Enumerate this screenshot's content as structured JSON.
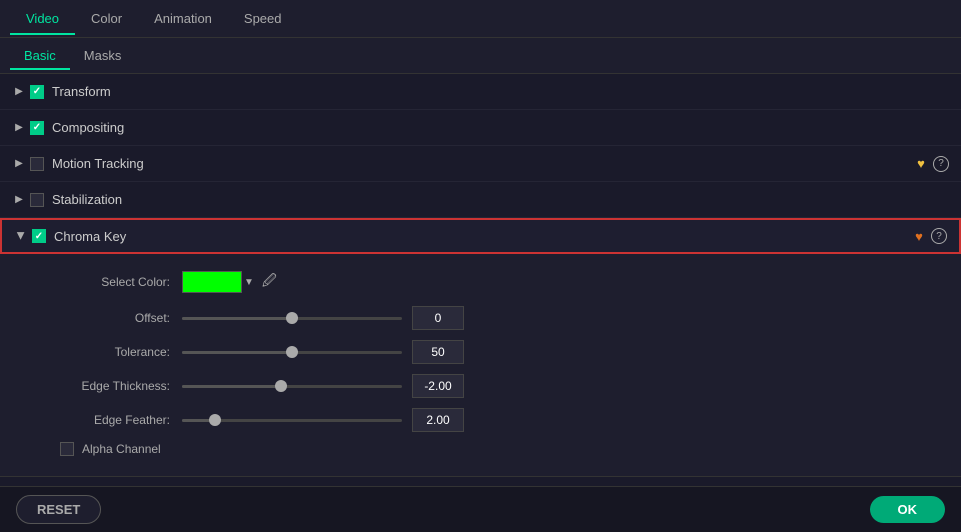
{
  "tabs": {
    "items": [
      {
        "label": "Video",
        "active": true
      },
      {
        "label": "Color",
        "active": false
      },
      {
        "label": "Animation",
        "active": false
      },
      {
        "label": "Speed",
        "active": false
      }
    ]
  },
  "sub_tabs": {
    "items": [
      {
        "label": "Basic",
        "active": true
      },
      {
        "label": "Masks",
        "active": false
      }
    ]
  },
  "sections": [
    {
      "label": "Transform",
      "checked": true,
      "expanded": false,
      "heart": false,
      "help": false
    },
    {
      "label": "Compositing",
      "checked": true,
      "expanded": false,
      "heart": false,
      "help": false
    },
    {
      "label": "Motion Tracking",
      "checked": false,
      "expanded": false,
      "heart": true,
      "heart_color": "yellow",
      "help": true
    },
    {
      "label": "Stabilization",
      "checked": false,
      "expanded": false,
      "heart": false,
      "help": false
    },
    {
      "label": "Chroma Key",
      "checked": true,
      "expanded": true,
      "heart": true,
      "heart_color": "orange",
      "help": true
    }
  ],
  "chroma_key": {
    "select_color_label": "Select Color:",
    "color": "#00ff00",
    "offset_label": "Offset:",
    "offset_value": "0",
    "offset_percent": 50,
    "tolerance_label": "Tolerance:",
    "tolerance_value": "50",
    "tolerance_percent": 50,
    "edge_thickness_label": "Edge Thickness:",
    "edge_thickness_value": "-2.00",
    "edge_thickness_percent": 45,
    "edge_feather_label": "Edge Feather:",
    "edge_feather_value": "2.00",
    "edge_feather_percent": 15,
    "alpha_channel_label": "Alpha Channel",
    "alpha_checked": false
  },
  "footer": {
    "reset_label": "RESET",
    "ok_label": "OK"
  }
}
